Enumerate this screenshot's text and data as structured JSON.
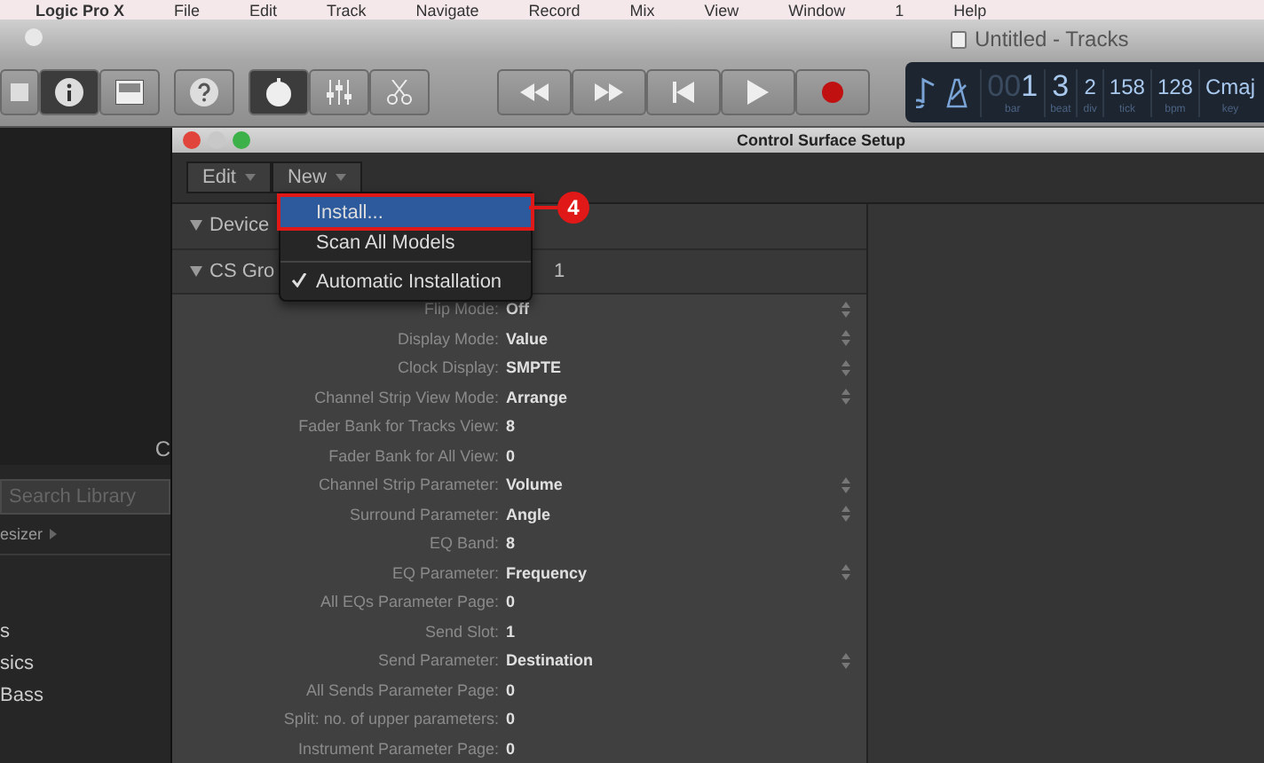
{
  "menu_bar": [
    "Logic Pro X",
    "File",
    "Edit",
    "Track",
    "Navigate",
    "Record",
    "Mix",
    "View",
    "Window",
    "1",
    "Help"
  ],
  "main_window": {
    "title": "Untitled - Tracks"
  },
  "lcd": {
    "fields": [
      {
        "prefix": "00",
        "value": "1",
        "label": "bar",
        "kind": "large"
      },
      {
        "value": "3",
        "label": "beat",
        "kind": "large"
      },
      {
        "value": "2",
        "label": "div",
        "kind": "small"
      },
      {
        "value": "158",
        "label": "tick",
        "kind": "small"
      },
      {
        "value": "128",
        "label": "bpm",
        "kind": "small"
      },
      {
        "value": "Cmaj",
        "label": "key",
        "kind": "small"
      }
    ]
  },
  "library": {
    "cut_text": "C",
    "search_placeholder": "Search Library",
    "category": "esizer",
    "items": [
      "s",
      "sics",
      "Bass"
    ]
  },
  "control_surface_setup": {
    "title": "Control Surface Setup",
    "toolbar": [
      "Edit",
      "New"
    ],
    "sections": [
      {
        "label": "Device",
        "expanded": true
      },
      {
        "label": "CS Gro",
        "value": "1",
        "expanded": true
      }
    ],
    "rows": [
      {
        "label": "Flip Mode:",
        "value": "Off",
        "stepper": true
      },
      {
        "label": "Display Mode:",
        "value": "Value",
        "stepper": true
      },
      {
        "label": "Clock Display:",
        "value": "SMPTE",
        "stepper": true
      },
      {
        "label": "Channel Strip View Mode:",
        "value": "Arrange",
        "stepper": true
      },
      {
        "label": "Fader Bank for Tracks View:",
        "value": "8",
        "stepper": false
      },
      {
        "label": "Fader Bank for All View:",
        "value": "0",
        "stepper": false
      },
      {
        "label": "Channel Strip Parameter:",
        "value": "Volume",
        "stepper": true
      },
      {
        "label": "Surround Parameter:",
        "value": "Angle",
        "stepper": true
      },
      {
        "label": "EQ Band:",
        "value": "8",
        "stepper": false
      },
      {
        "label": "EQ Parameter:",
        "value": "Frequency",
        "stepper": true
      },
      {
        "label": "All EQs Parameter Page:",
        "value": "0",
        "stepper": false
      },
      {
        "label": "Send Slot:",
        "value": "1",
        "stepper": false
      },
      {
        "label": "Send Parameter:",
        "value": "Destination",
        "stepper": true
      },
      {
        "label": "All Sends Parameter Page:",
        "value": "0",
        "stepper": false
      },
      {
        "label": "Split: no. of upper parameters:",
        "value": "0",
        "stepper": false
      },
      {
        "label": "Instrument Parameter Page:",
        "value": "0",
        "stepper": false
      }
    ]
  },
  "new_menu": {
    "items": [
      {
        "label": "Install...",
        "selected": true,
        "checked": false,
        "kind": "action"
      },
      {
        "label": "Scan All Models",
        "selected": false,
        "checked": false,
        "kind": "action"
      },
      {
        "label": "Automatic Installation",
        "selected": false,
        "checked": true,
        "kind": "toggle"
      }
    ]
  },
  "callout": {
    "number": "4"
  }
}
